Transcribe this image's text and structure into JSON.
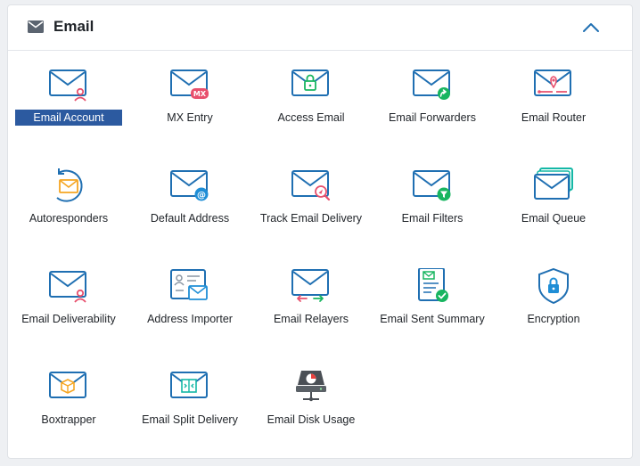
{
  "section": {
    "title": "Email",
    "collapse_icon": "chevron-up-icon",
    "header_icon": "envelope-icon"
  },
  "colors": {
    "accent_blue": "#1f6fb2",
    "pink": "#e8506d",
    "green": "#18b560",
    "orange": "#f5a623",
    "teal": "#14b8a6",
    "selection": "#2c5aa0"
  },
  "items": [
    {
      "label": "Email Account",
      "icon": "email-account-icon",
      "selected": true
    },
    {
      "label": "MX Entry",
      "icon": "mx-entry-icon"
    },
    {
      "label": "Access Email",
      "icon": "access-email-icon"
    },
    {
      "label": "Email Forwarders",
      "icon": "email-forwarders-icon"
    },
    {
      "label": "Email Router",
      "icon": "email-router-icon"
    },
    {
      "label": "Autoresponders",
      "icon": "autoresponders-icon"
    },
    {
      "label": "Default Address",
      "icon": "default-address-icon"
    },
    {
      "label": "Track Email Delivery",
      "icon": "track-email-delivery-icon"
    },
    {
      "label": "Email Filters",
      "icon": "email-filters-icon"
    },
    {
      "label": "Email Queue",
      "icon": "email-queue-icon"
    },
    {
      "label": "Email Deliverability",
      "icon": "email-deliverability-icon"
    },
    {
      "label": "Address Importer",
      "icon": "address-importer-icon"
    },
    {
      "label": "Email Relayers",
      "icon": "email-relayers-icon"
    },
    {
      "label": "Email Sent Summary",
      "icon": "email-sent-summary-icon"
    },
    {
      "label": "Encryption",
      "icon": "encryption-icon"
    },
    {
      "label": "Boxtrapper",
      "icon": "boxtrapper-icon"
    },
    {
      "label": "Email Split Delivery",
      "icon": "email-split-delivery-icon"
    },
    {
      "label": "Email Disk Usage",
      "icon": "email-disk-usage-icon"
    }
  ]
}
